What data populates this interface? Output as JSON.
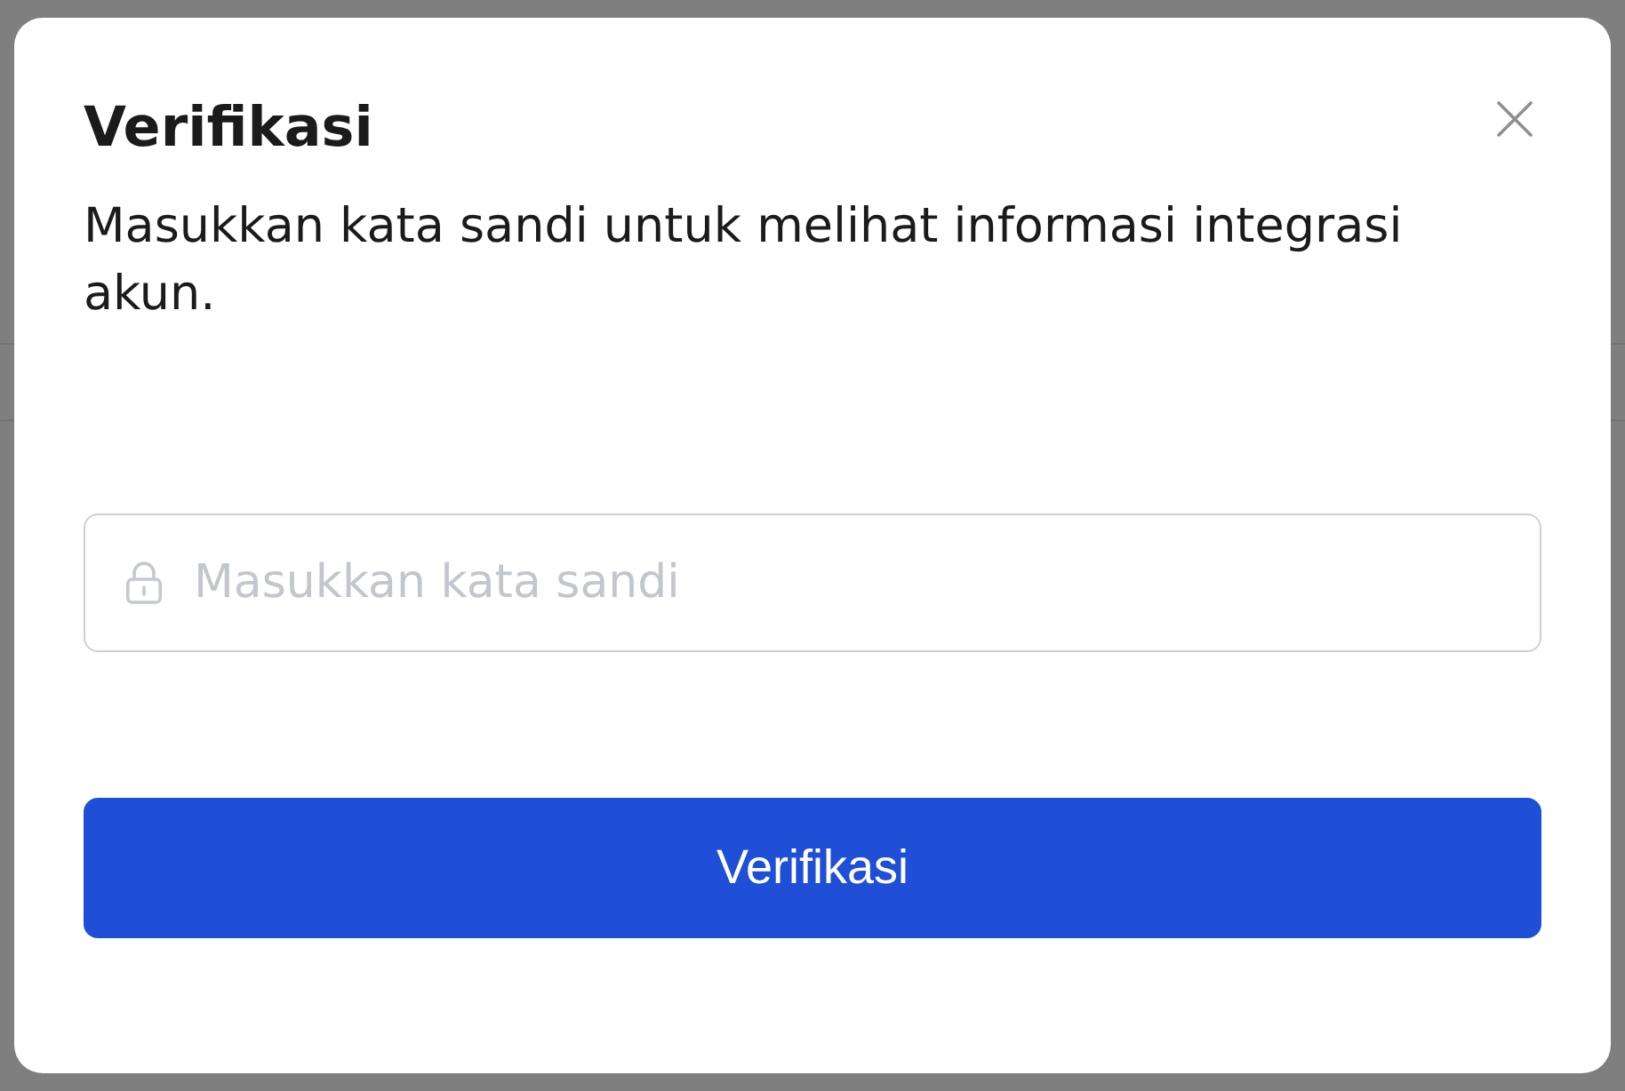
{
  "dialog": {
    "title": "Verifikasi",
    "message": "Masukkan kata sandi untuk melihat informasi integrasi akun.",
    "password_field": {
      "placeholder": "Masukkan kata sandi"
    },
    "submit_button": {
      "label": "Verifikasi"
    }
  }
}
